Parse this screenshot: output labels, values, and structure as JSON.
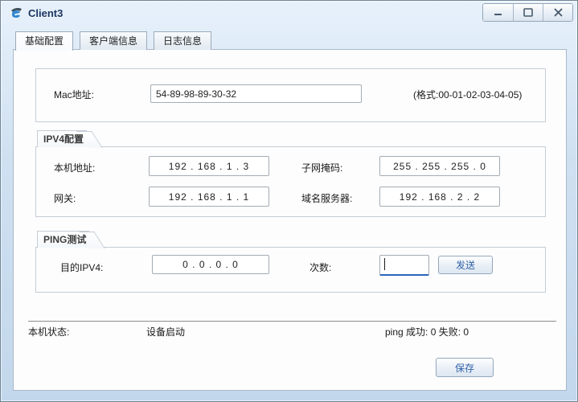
{
  "window": {
    "title": "Client3"
  },
  "tabs": [
    {
      "label": "基础配置",
      "active": true
    },
    {
      "label": "客户端信息",
      "active": false
    },
    {
      "label": "日志信息",
      "active": false
    }
  ],
  "basic": {
    "mac_label": "Mac地址:",
    "mac_value": "54-89-98-89-30-32",
    "mac_hint": "(格式:00-01-02-03-04-05)"
  },
  "ipv4": {
    "group_label": "IPV4配置",
    "host_label": "本机地址:",
    "host_value": "192 . 168 . 1 . 3",
    "mask_label": "子网掩码:",
    "mask_value": "255 . 255 . 255 . 0",
    "gateway_label": "网关:",
    "gateway_value": "192 . 168 . 1 . 1",
    "dns_label": "域名服务器:",
    "dns_value": "192 . 168 . 2 . 2"
  },
  "ping": {
    "group_label": "PING测试",
    "dest_label": "目的IPV4:",
    "dest_value": "0 . 0 . 0 . 0",
    "count_label": "次数:",
    "count_value": "",
    "send_label": "发送"
  },
  "status": {
    "label": "本机状态:",
    "value": "设备启动",
    "ping_stats": "ping 成功: 0 失败: 0"
  },
  "footer": {
    "save_label": "保存"
  },
  "colors": {
    "accent_button_text": "#3062a8",
    "focus_underline": "#2a66b8",
    "titlebar": "#d5e4f3"
  }
}
